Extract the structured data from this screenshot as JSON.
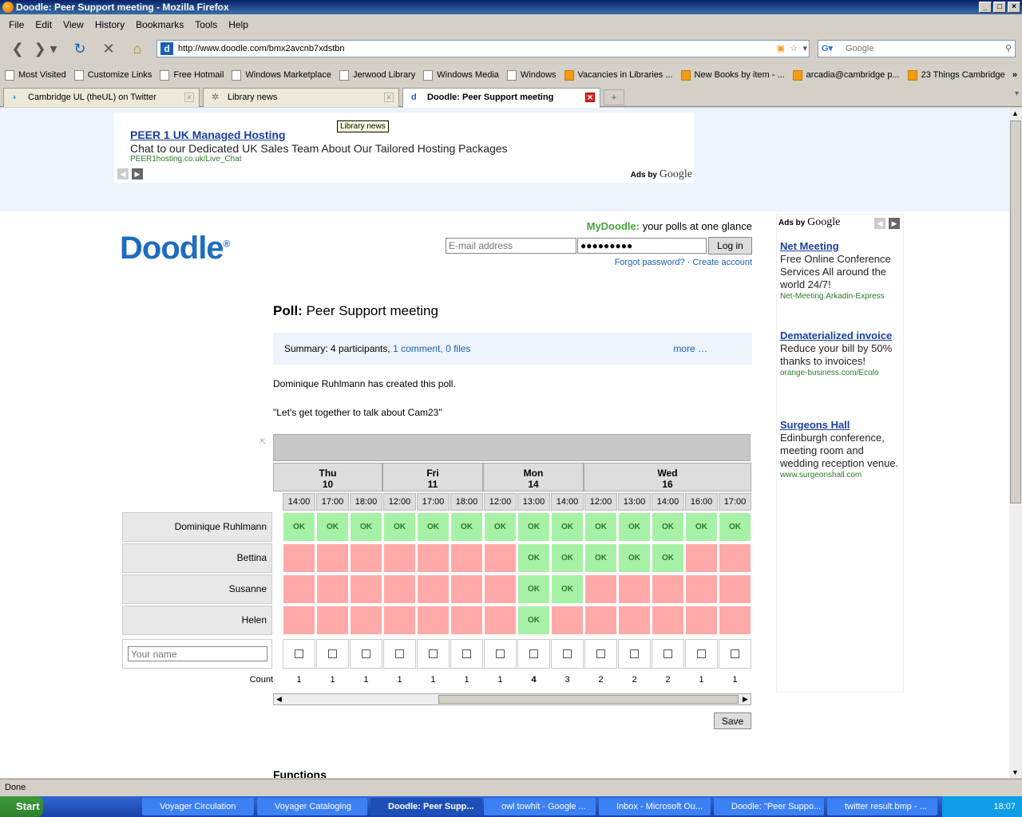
{
  "window": {
    "title": "Doodle: Peer Support meeting - Mozilla Firefox"
  },
  "menu": [
    "File",
    "Edit",
    "View",
    "History",
    "Bookmarks",
    "Tools",
    "Help"
  ],
  "nav": {
    "url": "http://www.doodle.com/bmx2avcnb7xdstbn",
    "search_placeholder": "Google"
  },
  "bookmarks": [
    {
      "label": "Most Visited",
      "type": "page"
    },
    {
      "label": "Customize Links",
      "type": "page"
    },
    {
      "label": "Free Hotmail",
      "type": "page"
    },
    {
      "label": "Windows Marketplace",
      "type": "page"
    },
    {
      "label": "Jerwood Library",
      "type": "page"
    },
    {
      "label": "Windows Media",
      "type": "page"
    },
    {
      "label": "Windows",
      "type": "page"
    },
    {
      "label": "Vacancies in Libraries ...",
      "type": "rss"
    },
    {
      "label": "New Books by item - ...",
      "type": "rss"
    },
    {
      "label": "arcadia@cambridge p...",
      "type": "rss"
    },
    {
      "label": "23 Things Cambridge",
      "type": "rss"
    }
  ],
  "tabs": [
    {
      "label": "Cambridge UL (theUL) on Twitter",
      "active": false
    },
    {
      "label": "Library news",
      "active": false
    },
    {
      "label": "Doodle: Peer Support meeting",
      "active": true
    }
  ],
  "tooltip": "Library news",
  "topad": {
    "title": "PEER 1 UK Managed Hosting",
    "text": "Chat to our Dedicated UK Sales Team About Our Tailored Hosting Packages",
    "url": "PEER1hosting.co.uk/Live_Chat",
    "ads_by": "Ads by",
    "google": "Google"
  },
  "doodle": {
    "logo": "Doodle",
    "mydoodle_label": "MyDoodle:",
    "mydoodle_text": "your polls at one glance",
    "email_placeholder": "E-mail address",
    "password_value": "●●●●●●●●●",
    "login": "Log in",
    "forgot": "Forgot password? · Create account"
  },
  "poll": {
    "label": "Poll:",
    "title": "Peer Support meeting",
    "summary": "Summary: 4 participants,",
    "comments": "1 comment, 0 files",
    "more": "more …",
    "created": "Dominique Ruhlmann has created this poll.",
    "quote": "\"Let's get together to talk about Cam23\""
  },
  "grid": {
    "dates": [
      {
        "day": "Thu",
        "num": "10"
      },
      {
        "day": "Fri",
        "num": "11"
      },
      {
        "day": "Mon",
        "num": "14"
      },
      {
        "day": "Wed",
        "num": "16"
      }
    ],
    "times": [
      "14:00",
      "17:00",
      "18:00",
      "12:00",
      "17:00",
      "18:00",
      "12:00",
      "13:00",
      "14:00",
      "12:00",
      "13:00",
      "14:00",
      "16:00",
      "17:00"
    ],
    "participants": [
      {
        "name": "Dominique Ruhlmann",
        "votes": [
          1,
          1,
          1,
          1,
          1,
          1,
          1,
          1,
          1,
          1,
          1,
          1,
          1,
          1
        ]
      },
      {
        "name": "Bettina",
        "votes": [
          0,
          0,
          0,
          0,
          0,
          0,
          0,
          1,
          1,
          1,
          1,
          1,
          0,
          0
        ]
      },
      {
        "name": "Susanne",
        "votes": [
          0,
          0,
          0,
          0,
          0,
          0,
          0,
          1,
          1,
          0,
          0,
          0,
          0,
          0
        ]
      },
      {
        "name": "Helen",
        "votes": [
          0,
          0,
          0,
          0,
          0,
          0,
          0,
          1,
          0,
          0,
          0,
          0,
          0,
          0
        ]
      }
    ],
    "ok_label": "OK",
    "yourname_placeholder": "Your name",
    "count_label": "Count",
    "counts": [
      "1",
      "1",
      "1",
      "1",
      "1",
      "1",
      "1",
      "4",
      "3",
      "2",
      "2",
      "2",
      "1",
      "1"
    ],
    "save": "Save"
  },
  "functions": "Functions",
  "sidead": {
    "ads_by": "Ads by",
    "google": "Google",
    "items": [
      {
        "title": "Net Meeting",
        "text": "Free Online Conference Services All around the world 24/7!",
        "url": "Net-Meeting.Arkadin-Express"
      },
      {
        "title": "Dematerialized invoice",
        "text": "Reduce your bill by 50% thanks to invoices!",
        "url": "orange-business.com/Ecolo"
      },
      {
        "title": "Surgeons Hall",
        "text": "Edinburgh conference, meeting room and wedding reception venue.",
        "url": "www.surgeonshall.com"
      }
    ]
  },
  "status": "Done",
  "taskbar": {
    "start": "Start",
    "items": [
      {
        "label": "Voyager Circulation",
        "active": false
      },
      {
        "label": "Voyager Cataloging",
        "active": false
      },
      {
        "label": "Doodle: Peer Supp...",
        "active": true
      },
      {
        "label": "owl towhit - Google ...",
        "active": false
      },
      {
        "label": "Inbox - Microsoft Ou...",
        "active": false
      },
      {
        "label": "Doodle: \"Peer Suppo...",
        "active": false
      },
      {
        "label": "twitter result.bmp - ...",
        "active": false
      }
    ],
    "clock": "18:07"
  }
}
